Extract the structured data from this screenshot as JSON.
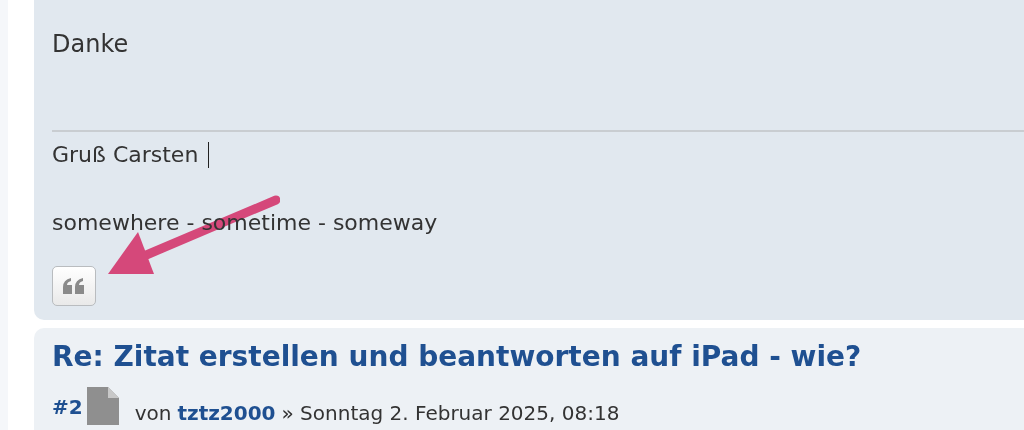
{
  "post": {
    "body": "Danke",
    "signature": [
      "Gruß Carsten",
      "somewhere - sometime - someway"
    ]
  },
  "next_post": {
    "title": "Re: Zitat erstellen und beantworten auf iPad - wie?",
    "number": "#2",
    "by": "von",
    "author": "tztz2000",
    "date": "» Sonntag 2. Februar 2025, 08:18"
  }
}
